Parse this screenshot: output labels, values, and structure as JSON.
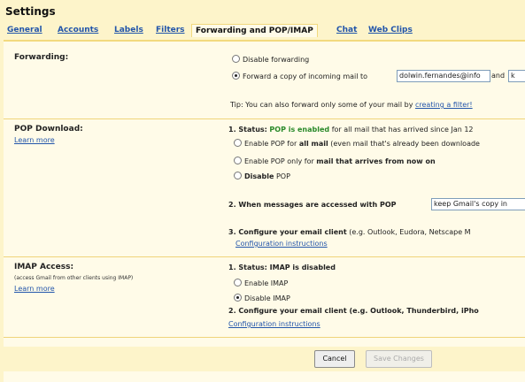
{
  "window": {
    "title": "Settings"
  },
  "tabs": [
    {
      "label": "General"
    },
    {
      "label": "Accounts"
    },
    {
      "label": "Labels"
    },
    {
      "label": "Filters"
    },
    {
      "label": "Forwarding and POP/IMAP",
      "active": true
    },
    {
      "label": "Chat"
    },
    {
      "label": "Web Clips"
    }
  ],
  "forwarding": {
    "heading": "Forwarding:",
    "option_disable": "Disable forwarding",
    "option_forward": "Forward a copy of incoming mail to",
    "forward_address": "dolwin.fernandes@info",
    "and_label": "and",
    "and_value": "k",
    "tip_prefix": "Tip: You can also forward only some of your mail by",
    "tip_link": "creating a filter!"
  },
  "pop": {
    "heading": "POP Download:",
    "learn_more": "Learn more",
    "status_prefix": "1. Status:",
    "status_value": "POP is enabled",
    "status_suffix": "for all mail that has arrived since Jan 12",
    "opt_all_prefix": "Enable POP for",
    "opt_all_bold": "all mail",
    "opt_all_suffix": "(even mail that's already been downloade",
    "opt_now_prefix": "Enable POP only for",
    "opt_now_bold": "mail that arrives from now on",
    "opt_disable_bold": "Disable",
    "opt_disable_suffix": "POP",
    "when_accessed": "2. When messages are accessed with POP",
    "when_value": "keep Gmail's copy in",
    "configure_bold": "3. Configure your email client",
    "configure_suffix": "(e.g. Outlook, Eudora, Netscape M",
    "config_link": "Configuration instructions"
  },
  "imap": {
    "heading": "IMAP Access:",
    "subtext": "(access Gmail from other clients using IMAP)",
    "learn_more": "Learn more",
    "status": "1. Status: IMAP is disabled",
    "opt_enable": "Enable IMAP",
    "opt_disable": "Disable IMAP",
    "configure": "2. Configure your email client (e.g. Outlook, Thunderbird, iPho",
    "config_link": "Configuration instructions"
  },
  "actions": {
    "cancel": "Cancel",
    "save": "Save Changes"
  }
}
